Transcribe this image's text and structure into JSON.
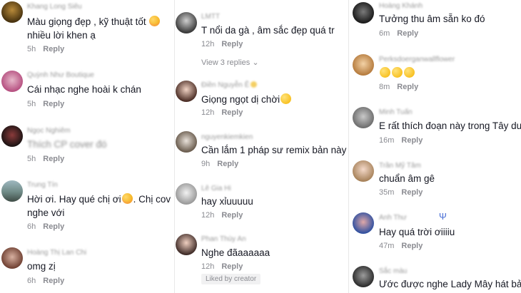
{
  "actions": {
    "reply": "Reply"
  },
  "colors": {
    "text": "#161823",
    "muted": "#8a8b91",
    "background": "#ffffff"
  },
  "col1": [
    {
      "username": "Khang Long Siêu",
      "text1": "Màu giọng đẹp , kỹ thuật tốt",
      "text2": "nhiều lời khen ạ",
      "time": "5h"
    },
    {
      "username": "Quỳnh Như Boutique",
      "text1": "Cái nhạc nghe hoài k chán",
      "time": "5h"
    },
    {
      "username": "Ngọc Nghiêm",
      "text1": "Thích CP cover đó",
      "time": "5h"
    },
    {
      "username": "Trung Tín",
      "text1": "Hời ơi. Hay qué chị ơi",
      "text1b": ". Chị cov",
      "text2": "nghe với",
      "time": "6h"
    },
    {
      "username": "Hoàng Thị Lan Chi",
      "text1": "omg zị",
      "time": "6h"
    }
  ],
  "col2": [
    {
      "username": "LMTT",
      "text1": "T nổi da gà , âm sắc đẹp quá tr",
      "time": "12h",
      "view_replies": "View 3 replies"
    },
    {
      "username": "Điền Nguyễn Ê",
      "text1": "Giọng ngọt dị chời",
      "time": "12h"
    },
    {
      "username": "nguyenkiemkien",
      "text1": "Cần lắm 1 pháp sư remix bản này =",
      "time": "9h"
    },
    {
      "username": "Lê Gia Hi",
      "text1": "hay xỉuuuuu",
      "time": "12h"
    },
    {
      "username": "Phan Thùy An",
      "text1": "Nghe đãaaaaaa",
      "time": "12h",
      "badge": "Liked by creator"
    }
  ],
  "col3": [
    {
      "username": "Hoàng Khánh",
      "text1": "Tưởng thu âm sẵn ko đó",
      "time": "6m"
    },
    {
      "username": "Perksdoerganwallflower",
      "text1": "",
      "time": "8m"
    },
    {
      "username": "Minh Tuấn",
      "text1": "E rất thích đoạn này trong Tây du",
      "time": "16m"
    },
    {
      "username": "Trần Mỹ Tâm",
      "text1": "chuẩn âm gê",
      "time": "35m"
    },
    {
      "username": "Anh Thư",
      "text1": "Hay quá trời ơiiiiu",
      "time": "47m"
    },
    {
      "username": "Sắc màu",
      "text1": "Ước được nghe Lady Mây hát bả",
      "time": ""
    }
  ]
}
